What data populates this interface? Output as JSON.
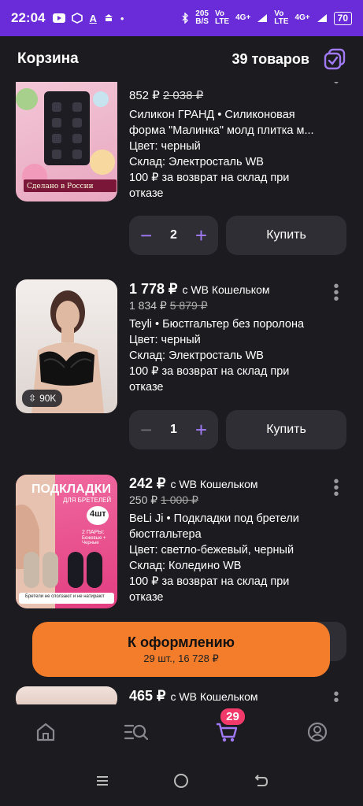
{
  "status": {
    "time": "22:04",
    "network": "205\nB/S",
    "battery": "70",
    "lte1": "Vo\nLTE",
    "lte2": "Vo\nLTE",
    "g4": "4G+"
  },
  "header": {
    "title": "Корзина",
    "count": "39 товаров"
  },
  "items": [
    {
      "price": "852 ₽",
      "old_price": "2 038 ₽",
      "name1": "Силикон ГРАНД • Силиконовая",
      "name2": "форма \"Малинка\" молд плитка м...",
      "color": "Цвет: черный",
      "warehouse": "Склад: Электросталь WB",
      "return1": "100 ₽ за возврат на склад при",
      "return2": "отказе",
      "qty": "2",
      "buy": "Купить",
      "thumb_text": "Сделано в России"
    },
    {
      "price": "1 778 ₽",
      "wallet": "с WB Кошельком",
      "old_price_a": "1 834 ₽",
      "old_price_b": "5 879 ₽",
      "name1": "Teyli • Бюстгальтер без поролона",
      "color": "Цвет: черный",
      "warehouse": "Склад: Электросталь WB",
      "return1": "100 ₽ за возврат на склад при",
      "return2": "отказе",
      "qty": "1",
      "buy": "Купить",
      "views": "90K"
    },
    {
      "price": "242 ₽",
      "wallet": "с WB Кошельком",
      "old_price_a": "250 ₽",
      "old_price_b": "1 000 ₽",
      "name1": "BeLi Ji • Подкладки под бретели",
      "name2": "бюстгальтера",
      "color": "Цвет: светло-бежевый, черный",
      "warehouse": "Склад: Коледино WB",
      "return1": "100 ₽ за возврат на склад при",
      "return2": "отказе",
      "thumb_title": "ПОДКЛАДКИ",
      "thumb_sub": "ДЛЯ БРЕТЕЛЕЙ",
      "thumb_badge": "4шт",
      "thumb_pairs": "2 ПАРЫ:",
      "thumb_colors": "Бежевые +\nЧерные",
      "thumb_foot": "Бретели не сползают и не натирают"
    },
    {
      "price": "465 ₽",
      "wallet": "с WB Кошельком"
    }
  ],
  "checkout": {
    "label": "К оформлению",
    "sub": "29 шт., 16 728 ₽"
  },
  "nav": {
    "cart_badge": "29"
  },
  "colors": {
    "accent": "#a07af5",
    "checkout": "#f47d2c",
    "statusbar": "#6a2bd8",
    "badge": "#f13a6a"
  }
}
